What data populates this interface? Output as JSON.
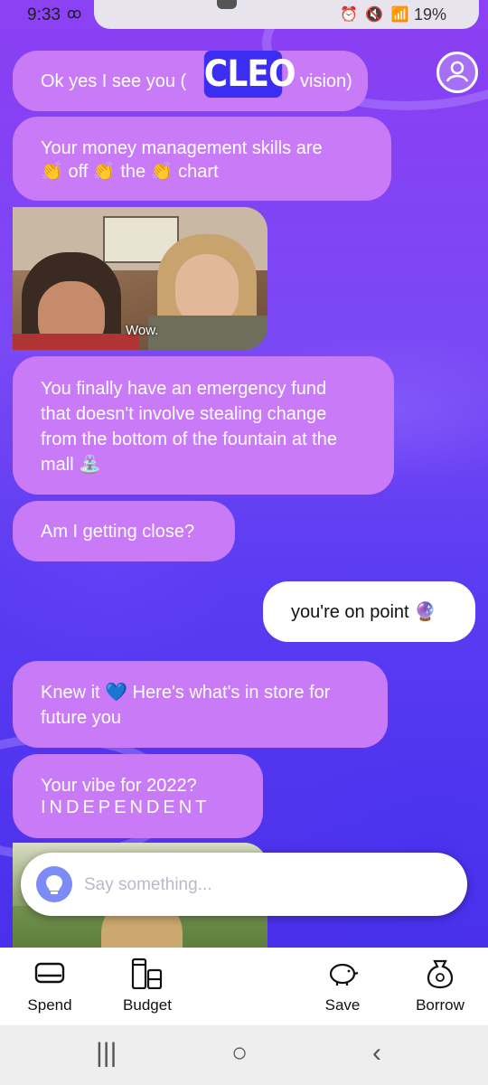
{
  "status_bar": {
    "time": "9:33",
    "voicemail_icon": "voicemail-icon",
    "icons": "⏰ 🔇 📶",
    "battery": "19%"
  },
  "header": {
    "logo": "CLEO",
    "profile_icon": "profile-icon"
  },
  "messages": [
    {
      "from": "cleo",
      "lines": [
        "Ok yes I see you (",
        "vision)"
      ]
    },
    {
      "from": "cleo",
      "lines": [
        "Your money management skills are",
        "👏 off 👏 the 👏 chart"
      ]
    },
    {
      "from": "cleo",
      "type": "gif",
      "caption": "Wow."
    },
    {
      "from": "cleo",
      "lines": [
        "You finally have an emergency fund",
        "that doesn't involve stealing change",
        "from the bottom of the fountain at the",
        "mall ⛲"
      ]
    },
    {
      "from": "cleo",
      "lines": [
        "Am I getting close?"
      ]
    },
    {
      "from": "user",
      "lines": [
        "you're on point 🔮"
      ]
    },
    {
      "from": "cleo",
      "lines": [
        "Knew it 💙 Here's what's in store for",
        "future you"
      ]
    },
    {
      "from": "cleo",
      "lines": [
        "Your vibe for 2022?",
        "INDEPENDENT"
      ]
    }
  ],
  "input": {
    "placeholder": "Say something...",
    "icon": "lightbulb-icon"
  },
  "bottom_nav": [
    {
      "label": "Spend",
      "icon": "card-icon"
    },
    {
      "label": "Budget",
      "icon": "budget-icon"
    },
    {
      "label": "Save",
      "icon": "piggy-bank-icon"
    },
    {
      "label": "Borrow",
      "icon": "money-bag-icon"
    }
  ],
  "system_nav": {
    "recents": "|||",
    "home": "○",
    "back": "‹"
  },
  "colors": {
    "cleo_bubble": "#c97bf7",
    "user_bubble": "#ffffff",
    "logo_bg": "#3b2ef2",
    "input_icon_bg": "#7d8bf7"
  }
}
